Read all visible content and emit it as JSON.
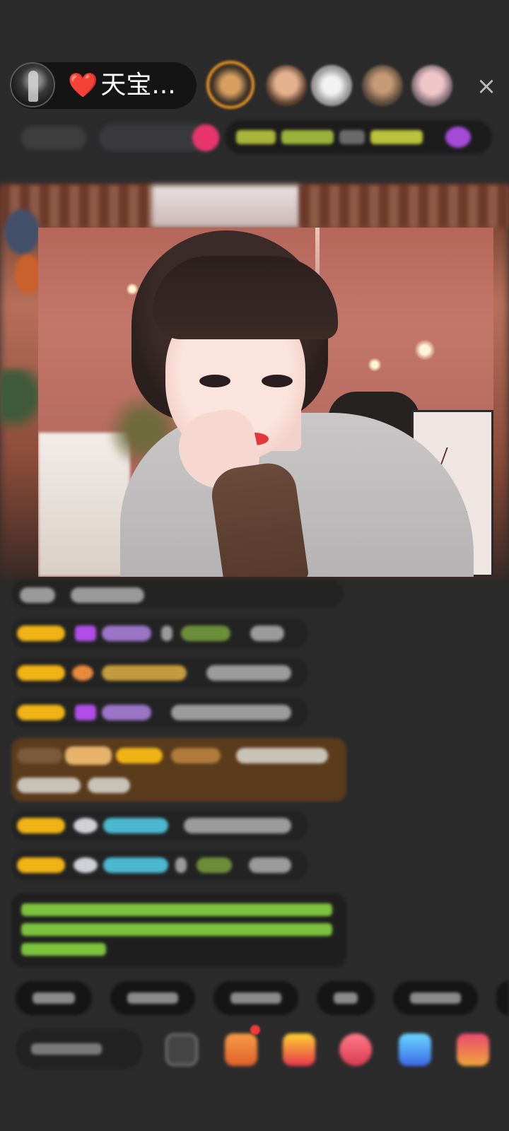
{
  "host": {
    "name": "天宝...",
    "heart": "❤️"
  },
  "header": {
    "close_glyph": "×"
  },
  "icons": {
    "close": "close-icon",
    "heart": "heart-icon",
    "gift": "gift-icon",
    "emoji": "emoji-icon"
  },
  "colors": {
    "accent_gold": "#f0b316",
    "accent_pink": "#e8356d",
    "background": "#2b2b2c",
    "chat_system_green": "#7cc23c",
    "highlight_row": "#5a3b1c"
  }
}
